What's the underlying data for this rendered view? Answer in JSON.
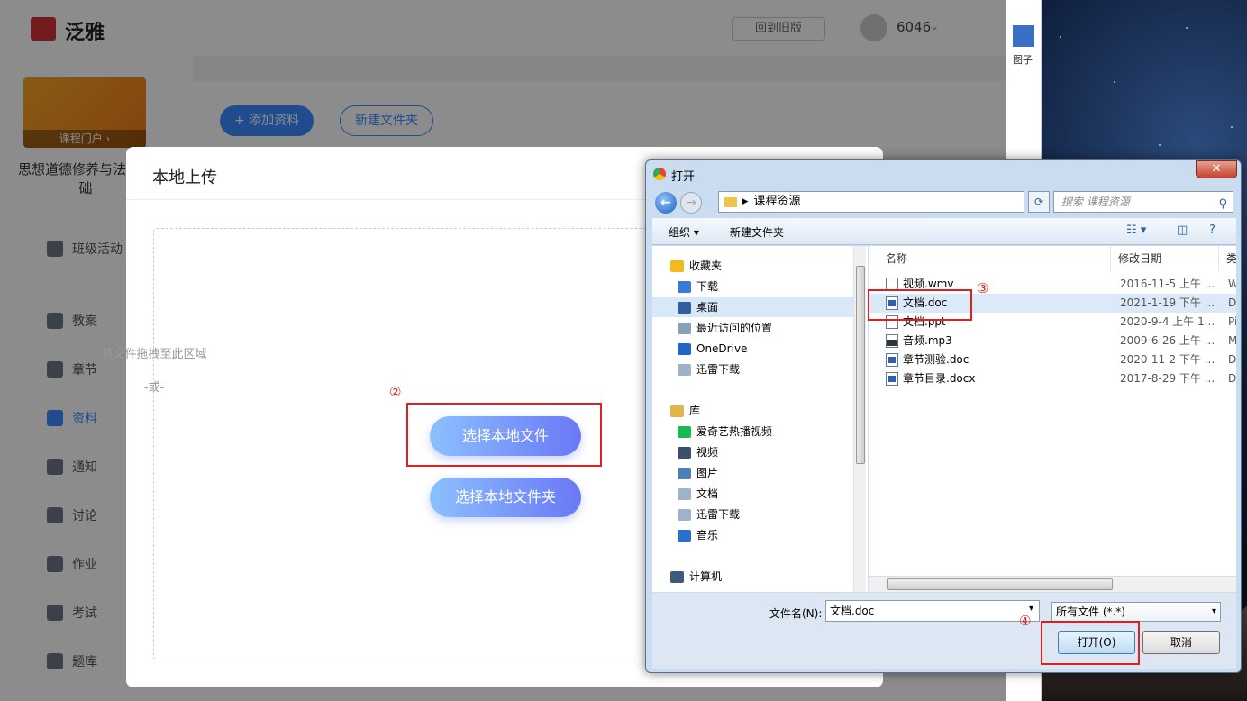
{
  "app": {
    "logo_text": "泛雅",
    "back_label": "回到旧版",
    "user_name": "6046",
    "course_cover_label": "课程门户 ›",
    "course_name": "思想道德修养与法律基础",
    "nav": [
      {
        "label": "班级活动"
      },
      {
        "label": "教案"
      },
      {
        "label": "章节"
      },
      {
        "label": "资料",
        "active": true
      },
      {
        "label": "通知"
      },
      {
        "label": "讨论"
      },
      {
        "label": "作业"
      },
      {
        "label": "考试"
      },
      {
        "label": "题库"
      }
    ],
    "add_label": "+ 添加资料",
    "new_folder_label": "新建文件夹",
    "accent_color": "#3a8bff"
  },
  "upload_modal": {
    "title": "本地上传",
    "drop_hint": "将文件拖拽至此区域",
    "or_text": "-或-",
    "select_file_label": "选择本地文件",
    "select_folder_label": "选择本地文件夹"
  },
  "annotations": {
    "step2": "②",
    "step3": "③",
    "step4": "④"
  },
  "open_dialog": {
    "title": "打开",
    "close_label": "✕",
    "address": "课程资源",
    "search_placeholder": "搜索 课程资源",
    "toolbar": {
      "organize": "组织 ▾",
      "new_folder": "新建文件夹"
    },
    "nav_tree": [
      {
        "label": "收藏夹",
        "icon": "star-icon",
        "indent": 0,
        "color": "#f3b91d"
      },
      {
        "label": "下载",
        "icon": "download-folder-icon",
        "indent": 1,
        "color": "#3b7bd8"
      },
      {
        "label": "桌面",
        "icon": "desktop-icon",
        "indent": 1,
        "color": "#2f5f9e",
        "selected": true
      },
      {
        "label": "最近访问的位置",
        "icon": "recent-places-icon",
        "indent": 1,
        "color": "#8aa0b8"
      },
      {
        "label": "OneDrive",
        "icon": "onedrive-icon",
        "indent": 1,
        "color": "#1f68c8"
      },
      {
        "label": "迅雷下载",
        "icon": "file-icon",
        "indent": 1,
        "color": "#9eb3c9"
      },
      {
        "label": "库",
        "icon": "library-icon",
        "indent": 0,
        "color": "#e0b64a"
      },
      {
        "label": "爱奇艺热播视频",
        "icon": "iqiyi-icon",
        "indent": 1,
        "color": "#19b955"
      },
      {
        "label": "视频",
        "icon": "video-icon",
        "indent": 1,
        "color": "#3b4e6a"
      },
      {
        "label": "图片",
        "icon": "picture-icon",
        "indent": 1,
        "color": "#4f7fb8"
      },
      {
        "label": "文档",
        "icon": "document-icon",
        "indent": 1,
        "color": "#9eb3c9"
      },
      {
        "label": "迅雷下载",
        "icon": "file-icon",
        "indent": 1,
        "color": "#9eb3c9"
      },
      {
        "label": "音乐",
        "icon": "music-icon",
        "indent": 1,
        "color": "#2a6fc9"
      },
      {
        "label": "计算机",
        "icon": "computer-icon",
        "indent": 0,
        "color": "#3c5a80"
      }
    ],
    "columns": {
      "name": "名称",
      "date": "修改日期",
      "type": "类"
    },
    "files": [
      {
        "name": "视频.wmv",
        "date": "2016-11-5 上午 ...",
        "type": "W",
        "icon": "video-file-icon"
      },
      {
        "name": "文档.doc",
        "date": "2021-1-19 下午 ...",
        "type": "D",
        "icon": "word-file-icon",
        "selected": true
      },
      {
        "name": "文档.ppt",
        "date": "2020-9-4 上午 1...",
        "type": "Pi",
        "icon": "ppt-file-icon"
      },
      {
        "name": "音频.mp3",
        "date": "2009-6-26 上午 ...",
        "type": "M",
        "icon": "mp3-file-icon"
      },
      {
        "name": "章节测验.doc",
        "date": "2020-11-2 下午 ...",
        "type": "D",
        "icon": "word-file-icon"
      },
      {
        "name": "章节目录.docx",
        "date": "2017-8-29 下午 ...",
        "type": "D",
        "icon": "word-file-icon"
      }
    ],
    "filename_label": "文件名(N):",
    "filename_value": "文档.doc",
    "filetype_value": "所有文件 (*.*)",
    "open_label": "打开(O)",
    "cancel_label": "取消"
  },
  "desktop": {
    "side_text": "图子"
  }
}
